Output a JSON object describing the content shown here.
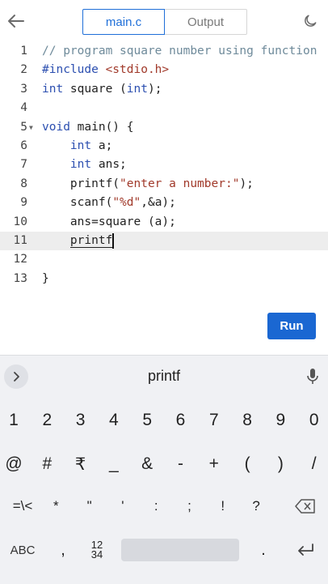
{
  "header": {
    "tabs": [
      {
        "label": "main.c",
        "active": true
      },
      {
        "label": "Output",
        "active": false
      }
    ],
    "accent_color": "#1f6fd8"
  },
  "editor": {
    "lines": [
      {
        "num": "1",
        "tokens": [
          {
            "t": "// program square number using function",
            "c": "cm"
          }
        ]
      },
      {
        "num": "2",
        "tokens": [
          {
            "t": "#include ",
            "c": "kw"
          },
          {
            "t": "<stdio.h>",
            "c": "st"
          }
        ]
      },
      {
        "num": "3",
        "tokens": [
          {
            "t": "int",
            "c": "ty"
          },
          {
            "t": " square (",
            "c": ""
          },
          {
            "t": "int",
            "c": "ty"
          },
          {
            "t": ");",
            "c": ""
          }
        ]
      },
      {
        "num": "4",
        "tokens": []
      },
      {
        "num": "5",
        "fold": true,
        "tokens": [
          {
            "t": "void",
            "c": "ty"
          },
          {
            "t": " main() {",
            "c": ""
          }
        ]
      },
      {
        "num": "6",
        "tokens": [
          {
            "t": "    ",
            "c": ""
          },
          {
            "t": "int",
            "c": "ty"
          },
          {
            "t": " a;",
            "c": ""
          }
        ]
      },
      {
        "num": "7",
        "tokens": [
          {
            "t": "    ",
            "c": ""
          },
          {
            "t": "int",
            "c": "ty"
          },
          {
            "t": " ans;",
            "c": ""
          }
        ]
      },
      {
        "num": "8",
        "tokens": [
          {
            "t": "    printf(",
            "c": ""
          },
          {
            "t": "\"enter a number:\"",
            "c": "st"
          },
          {
            "t": ");",
            "c": ""
          }
        ]
      },
      {
        "num": "9",
        "tokens": [
          {
            "t": "    scanf(",
            "c": ""
          },
          {
            "t": "\"%d\"",
            "c": "st"
          },
          {
            "t": ",&a);",
            "c": ""
          }
        ]
      },
      {
        "num": "10",
        "tokens": [
          {
            "t": "    ans=square (a);",
            "c": ""
          }
        ]
      },
      {
        "num": "11",
        "active": true,
        "tokens": [
          {
            "t": "    ",
            "c": ""
          },
          {
            "t": "printf",
            "c": "cursor-word"
          }
        ]
      },
      {
        "num": "12",
        "tokens": []
      },
      {
        "num": "13",
        "tokens": [
          {
            "t": "}",
            "c": ""
          }
        ]
      }
    ],
    "run_label": "Run"
  },
  "keyboard": {
    "suggestion": "printf",
    "row1": [
      "1",
      "2",
      "3",
      "4",
      "5",
      "6",
      "7",
      "8",
      "9",
      "0"
    ],
    "row2": [
      "@",
      "#",
      "₹",
      "_",
      "&",
      "-",
      "+",
      "(",
      ")",
      "/"
    ],
    "row3": [
      "=\\<",
      "*",
      "\"",
      "'",
      ":",
      ";",
      "!",
      "?"
    ],
    "abc_label": "ABC",
    "comma_label": ",",
    "numpad_label_top": "12",
    "numpad_label_bottom": "34",
    "period_label": "."
  }
}
